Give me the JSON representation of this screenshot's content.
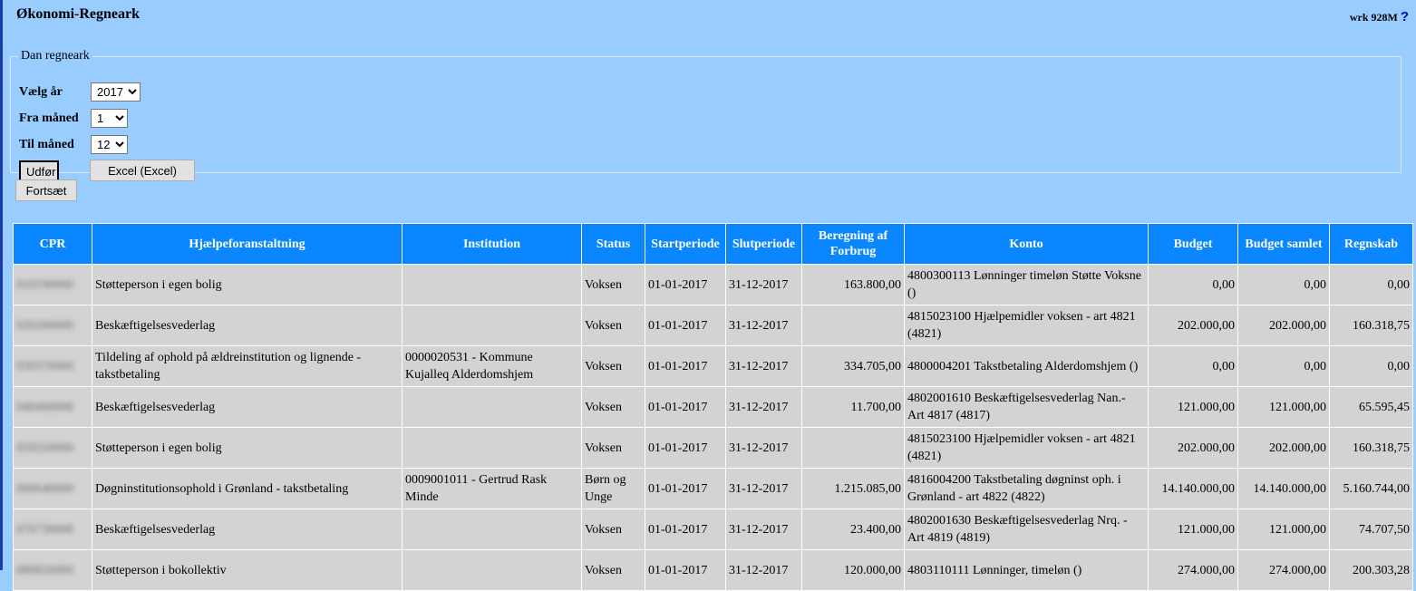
{
  "app_title": "Økonomi-Regneark",
  "top_right": {
    "text": "wrk 928M",
    "help": "?"
  },
  "form": {
    "legend": "Dan regneark",
    "year_label": "Vælg år",
    "year_value": "2017",
    "from_label": "Fra måned",
    "from_value": "1",
    "to_label": "Til måned",
    "to_value": "12",
    "execute_label": "Udfør",
    "excel_label": "Excel (Excel)"
  },
  "continue_label": "Fortsæt",
  "table": {
    "headers": [
      "CPR",
      "Hjælpeforanstaltning",
      "Institution",
      "Status",
      "Startperiode",
      "Slutperiode",
      "Beregning af Forbrug",
      "Konto",
      "Budget",
      "Budget samlet",
      "Regnskab"
    ],
    "rows": [
      {
        "cpr": "010190000",
        "hjaelp": "Støtteperson i egen bolig",
        "inst": "",
        "status": "Voksen",
        "start": "01-01-2017",
        "slut": "31-12-2017",
        "forbrug": "163.800,00",
        "konto": "4800300113 Lønninger timeløn Støtte Voksne ()",
        "budget": "0,00",
        "samlet": "0,00",
        "regnskab": "0,00"
      },
      {
        "cpr": "020280000",
        "hjaelp": "Beskæftigelsesvederlag",
        "inst": "",
        "status": "Voksen",
        "start": "01-01-2017",
        "slut": "31-12-2017",
        "forbrug": "",
        "konto": "4815023100 Hjælpemidler voksen - art 4821 (4821)",
        "budget": "202.000,00",
        "samlet": "202.000,00",
        "regnskab": "160.318,75"
      },
      {
        "cpr": "030370000",
        "hjaelp": "Tildeling af ophold på ældreinstitution og lignende - takstbetaling",
        "inst": "0000020531 - Kommune Kujalleq Alderdomshjem",
        "status": "Voksen",
        "start": "01-01-2017",
        "slut": "31-12-2017",
        "forbrug": "334.705,00",
        "konto": "4800004201 Takstbetaling Alderdomshjem ()",
        "budget": "0,00",
        "samlet": "0,00",
        "regnskab": "0,00"
      },
      {
        "cpr": "040460000",
        "hjaelp": "Beskæftigelsesvederlag",
        "inst": "",
        "status": "Voksen",
        "start": "01-01-2017",
        "slut": "31-12-2017",
        "forbrug": "11.700,00",
        "konto": "4802001610 Beskæftigelsesvederlag Nan.- Art 4817 (4817)",
        "budget": "121.000,00",
        "samlet": "121.000,00",
        "regnskab": "65.595,45"
      },
      {
        "cpr": "050550000",
        "hjaelp": "Støtteperson i egen bolig",
        "inst": "",
        "status": "Voksen",
        "start": "01-01-2017",
        "slut": "31-12-2017",
        "forbrug": "",
        "konto": "4815023100 Hjælpemidler voksen - art 4821 (4821)",
        "budget": "202.000,00",
        "samlet": "202.000,00",
        "regnskab": "160.318,75"
      },
      {
        "cpr": "060640000",
        "hjaelp": "Døgninstitutionsophold i Grønland - takstbetaling",
        "inst": "0009001011 - Gertrud Rask Minde",
        "status": "Børn og Unge",
        "start": "01-01-2017",
        "slut": "31-12-2017",
        "forbrug": "1.215.085,00",
        "konto": "4816004200 Takstbetaling døgninst oph. i Grønland - art 4822 (4822)",
        "budget": "14.140.000,00",
        "samlet": "14.140.000,00",
        "regnskab": "5.160.744,00"
      },
      {
        "cpr": "070730000",
        "hjaelp": "Beskæftigelsesvederlag",
        "inst": "",
        "status": "Voksen",
        "start": "01-01-2017",
        "slut": "31-12-2017",
        "forbrug": "23.400,00",
        "konto": "4802001630 Beskæftigelsesvederlag Nrq. - Art 4819 (4819)",
        "budget": "121.000,00",
        "samlet": "121.000,00",
        "regnskab": "74.707,50"
      },
      {
        "cpr": "080820000",
        "hjaelp": "Støtteperson i bokollektiv",
        "inst": "",
        "status": "Voksen",
        "start": "01-01-2017",
        "slut": "31-12-2017",
        "forbrug": "120.000,00",
        "konto": "4803110111 Lønninger, timeløn ()",
        "budget": "274.000,00",
        "samlet": "274.000,00",
        "regnskab": "200.303,28"
      }
    ]
  }
}
